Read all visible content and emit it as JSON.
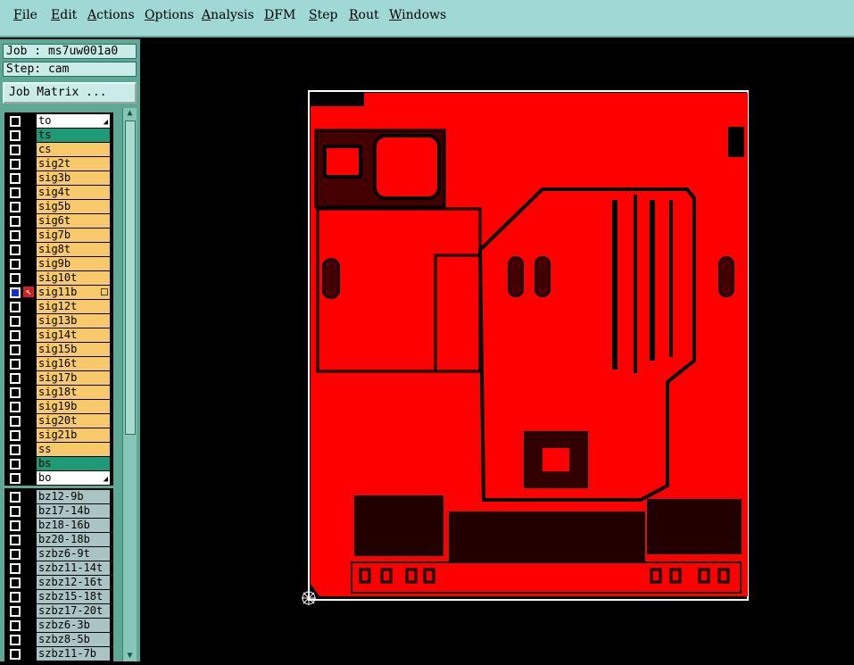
{
  "menu": [
    "File",
    "Edit",
    "Actions",
    "Options",
    "Analysis",
    "DFM",
    "Step",
    "Rout",
    "Windows"
  ],
  "job_label": "Job : ms7uw001a0",
  "step_label": "Step: cam",
  "job_matrix_button": "Job Matrix ...",
  "layers": [
    {
      "name": "to",
      "style": "white",
      "icon": "tri"
    },
    {
      "name": "ts",
      "style": "green"
    },
    {
      "name": "cs",
      "style": "sig"
    },
    {
      "name": "sig2t",
      "style": "sig"
    },
    {
      "name": "sig3b",
      "style": "sig"
    },
    {
      "name": "sig4t",
      "style": "sig"
    },
    {
      "name": "sig5b",
      "style": "sig"
    },
    {
      "name": "sig6t",
      "style": "sig"
    },
    {
      "name": "sig7b",
      "style": "sig"
    },
    {
      "name": "sig8t",
      "style": "sig"
    },
    {
      "name": "sig9b",
      "style": "sig"
    },
    {
      "name": "sig10t",
      "style": "sig"
    },
    {
      "name": "sig11b",
      "style": "sig",
      "selected": true
    },
    {
      "name": "sig12t",
      "style": "sig"
    },
    {
      "name": "sig13b",
      "style": "sig"
    },
    {
      "name": "sig14t",
      "style": "sig"
    },
    {
      "name": "sig15b",
      "style": "sig"
    },
    {
      "name": "sig16t",
      "style": "sig"
    },
    {
      "name": "sig17b",
      "style": "sig"
    },
    {
      "name": "sig18t",
      "style": "sig"
    },
    {
      "name": "sig19b",
      "style": "sig"
    },
    {
      "name": "sig20t",
      "style": "sig"
    },
    {
      "name": "sig21b",
      "style": "sig"
    },
    {
      "name": "ss",
      "style": "sig"
    },
    {
      "name": "bs",
      "style": "green"
    },
    {
      "name": "bo",
      "style": "white",
      "icon": "tri"
    }
  ],
  "drill_layers": [
    "bz12-9b",
    "bz17-14b",
    "bz18-16b",
    "bz20-18b",
    "szbz6-9t",
    "szbz11-14t",
    "szbz12-16t",
    "szbz15-18t",
    "szbz17-20t",
    "szbz6-3b",
    "szbz8-5b",
    "szbz11-7b"
  ],
  "colors": {
    "board_red": "#ff0000",
    "outline": "#ffffff",
    "background": "#000000"
  }
}
